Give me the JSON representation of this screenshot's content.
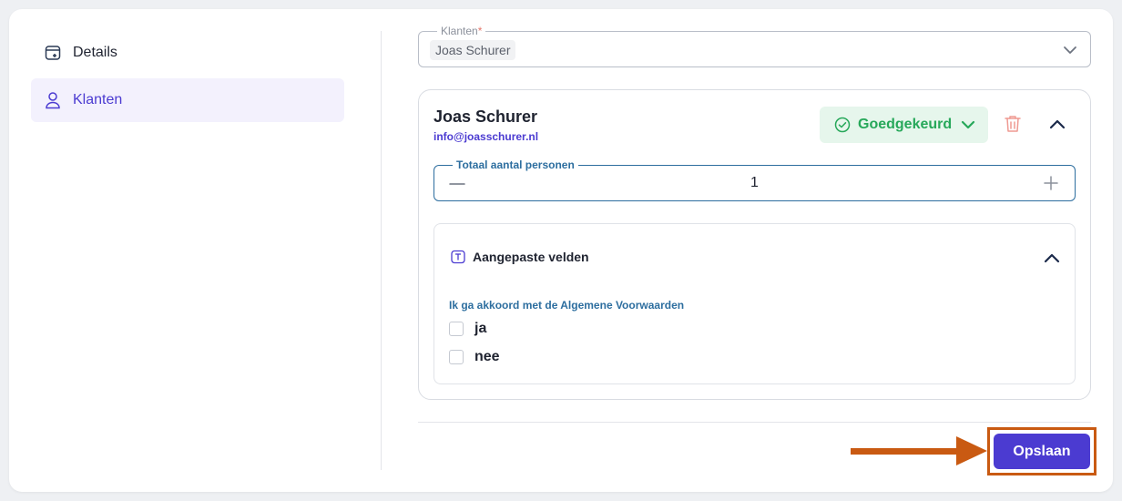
{
  "sidebar": {
    "items": [
      {
        "label": "Details",
        "icon": "calendar-plus-icon",
        "active": false
      },
      {
        "label": "Klanten",
        "icon": "user-icon",
        "active": true
      }
    ]
  },
  "client_select": {
    "label": "Klanten",
    "required_mark": "*",
    "selected": "Joas Schurer"
  },
  "client": {
    "name": "Joas Schurer",
    "email": "info@joasschurer.nl",
    "status": "Goedgekeurd",
    "status_color": "#27a85a"
  },
  "persons": {
    "label": "Totaal aantal personen",
    "value": "1"
  },
  "custom_fields": {
    "title": "Aangepaste velden",
    "terms_label": "Ik ga akkoord met de Algemene Voorwaarden",
    "options": [
      "ja",
      "nee"
    ]
  },
  "actions": {
    "save_label": "Opslaan"
  },
  "colors": {
    "accent": "#4b3bd1",
    "highlight": "#c95a12"
  }
}
